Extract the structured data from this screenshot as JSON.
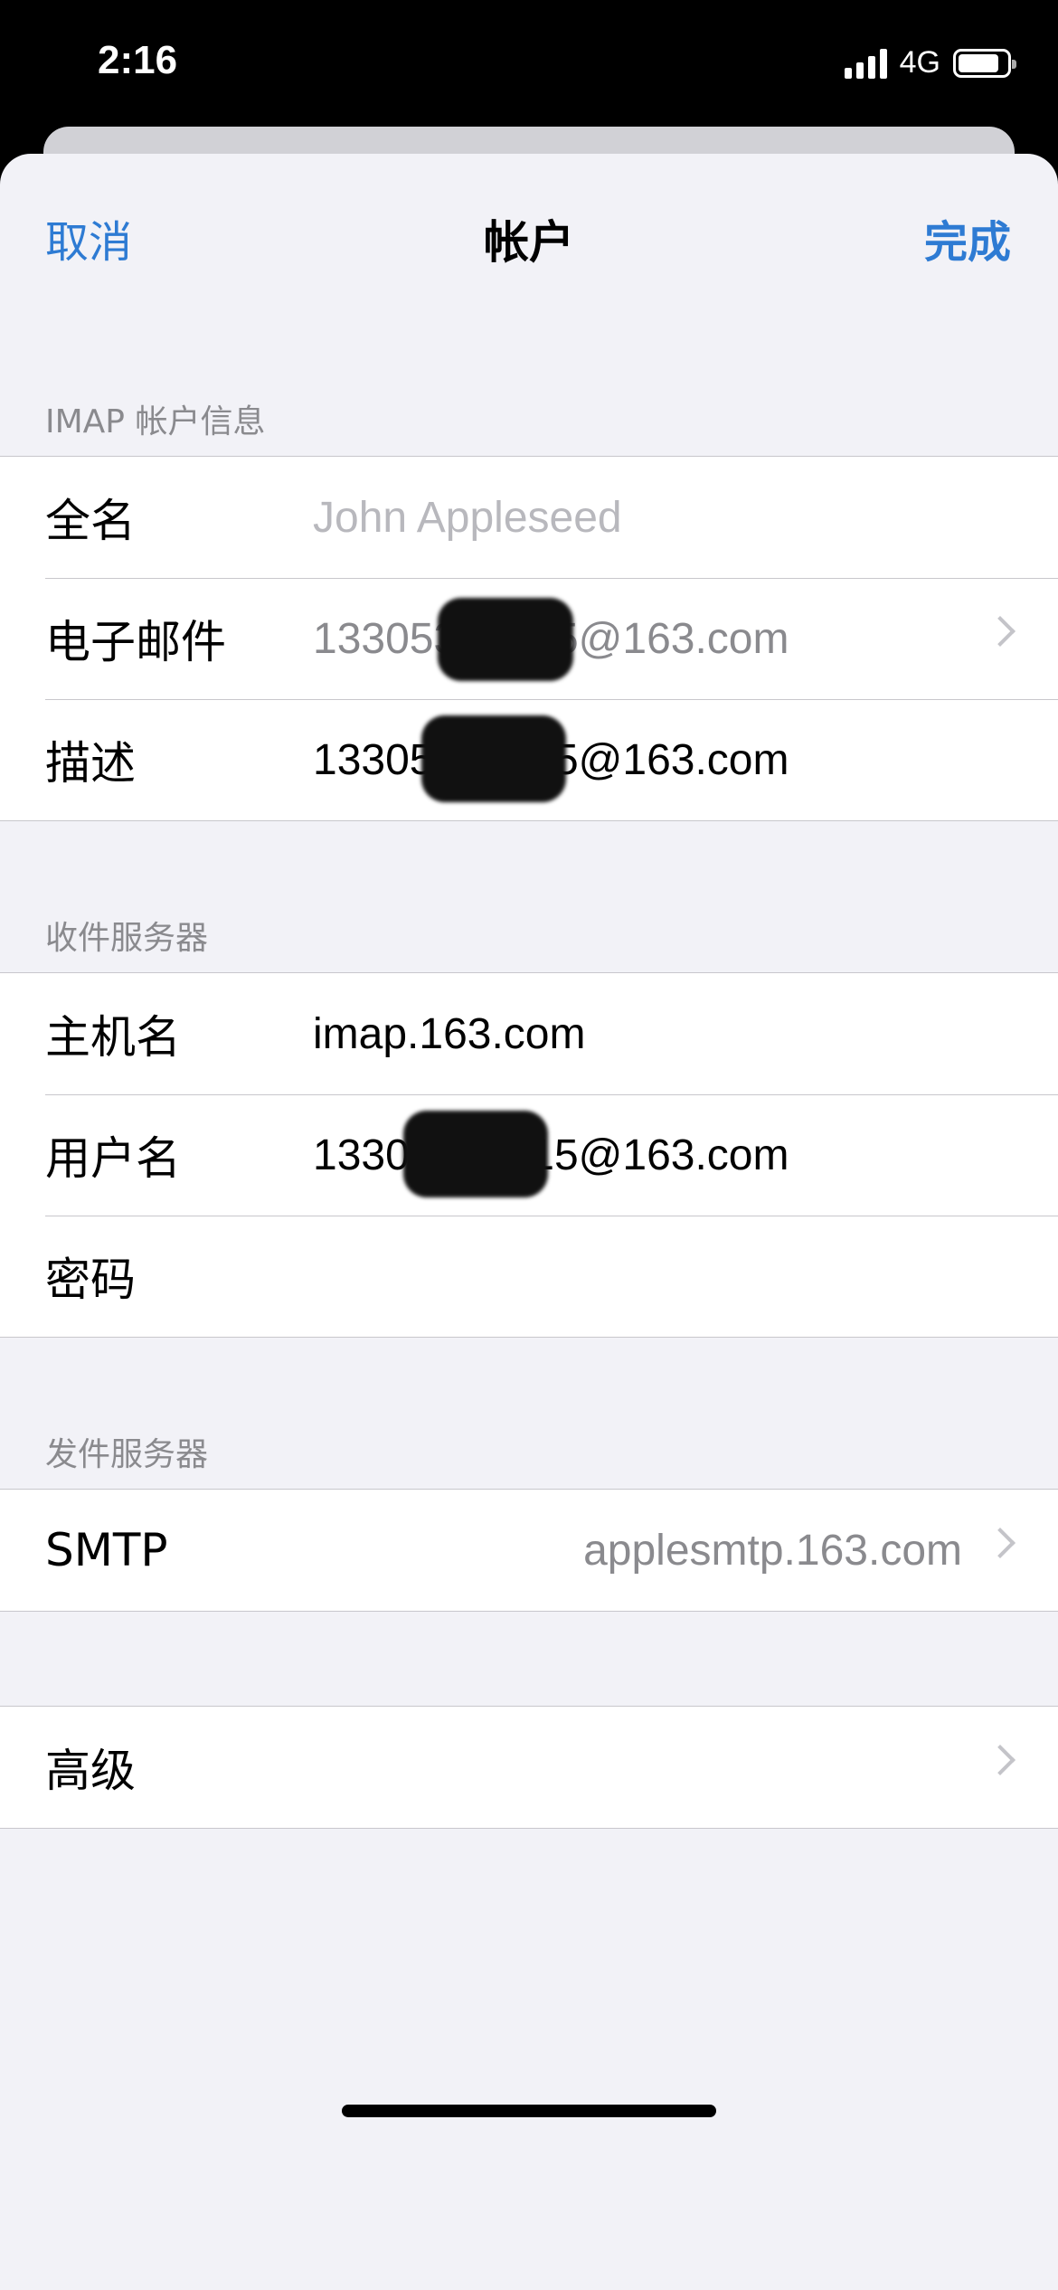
{
  "status_bar": {
    "time": "2:16",
    "network": "4G"
  },
  "nav": {
    "cancel": "取消",
    "title": "帐户",
    "done": "完成"
  },
  "sections": {
    "imap": {
      "header": "IMAP 帐户信息",
      "full_name": {
        "label": "全名",
        "placeholder": "John Appleseed"
      },
      "email": {
        "label": "电子邮件",
        "value": "13305376015@163.com"
      },
      "description": {
        "label": "描述",
        "value": "13305376015@163.com"
      }
    },
    "incoming": {
      "header": "收件服务器",
      "host": {
        "label": "主机名",
        "value": "imap.163.com"
      },
      "username": {
        "label": "用户名",
        "value": "13305376015@163.com"
      },
      "password": {
        "label": "密码",
        "value": ""
      }
    },
    "outgoing": {
      "header": "发件服务器",
      "smtp": {
        "label": "SMTP",
        "value": "applesmtp.163.com"
      }
    },
    "advanced": {
      "label": "高级"
    }
  },
  "colors": {
    "accent": "#2e7bd3",
    "background": "#f2f2f7",
    "secondary_text": "#8a8a8e"
  }
}
